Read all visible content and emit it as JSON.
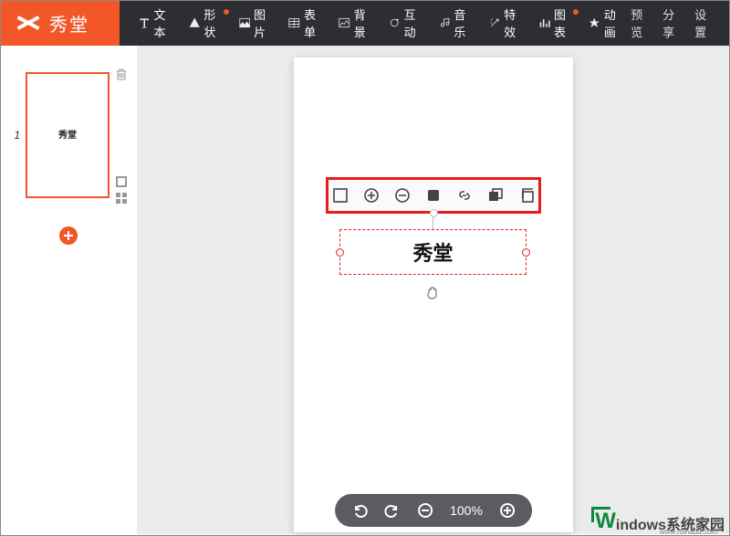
{
  "logo": {
    "name": "秀堂"
  },
  "nav": {
    "text": "文本",
    "shape": "形状",
    "image": "图片",
    "table": "表单",
    "background": "背景",
    "interact": "互动",
    "music": "音乐",
    "effect": "特效",
    "chart": "图表",
    "animation": "动画"
  },
  "nav_right": {
    "preview": "预览",
    "share": "分享",
    "settings": "设置"
  },
  "sidebar": {
    "page_number": "1",
    "thumb_text": "秀堂"
  },
  "canvas": {
    "selected_text": "秀堂"
  },
  "zoom": {
    "level": "100%"
  },
  "watermark": {
    "prefix": "W",
    "text": "indows系统家园",
    "sub": "www.ruihadu.com"
  }
}
